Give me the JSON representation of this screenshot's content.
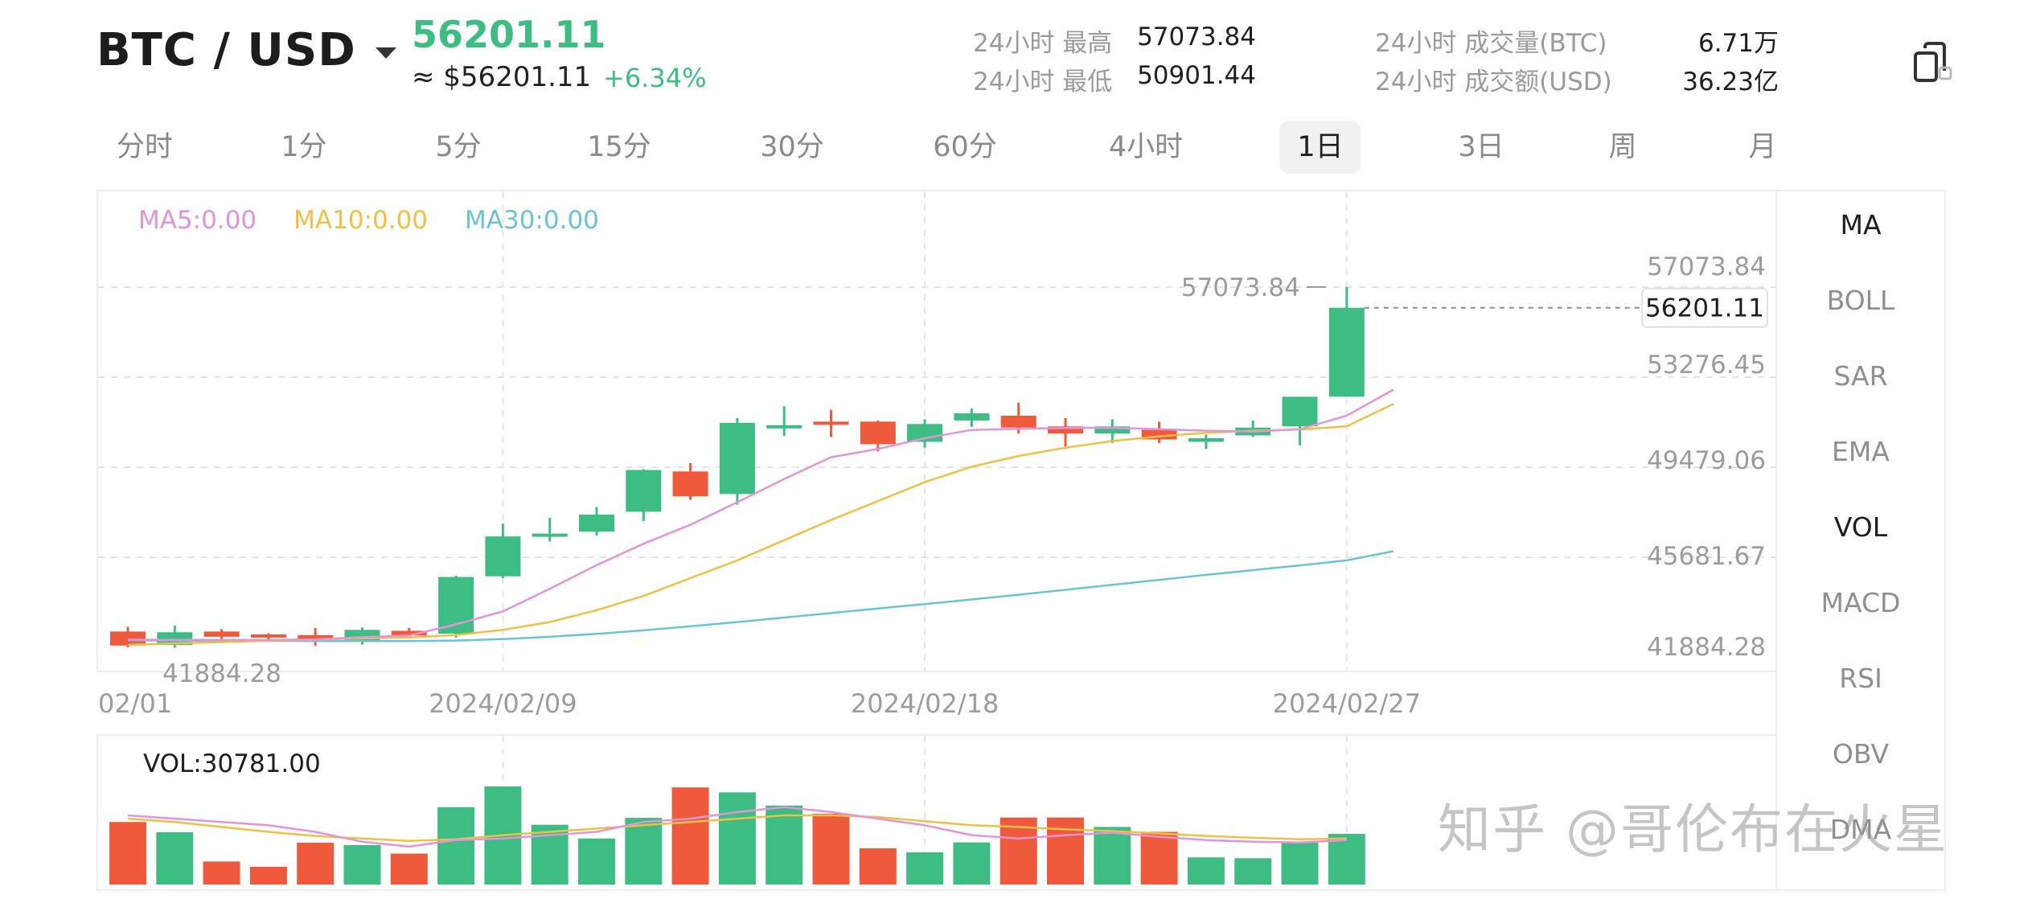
{
  "header": {
    "pair": "BTC  /  USD",
    "price": "56201.11",
    "price_usd": "≈ $56201.11",
    "change": "+6.34%",
    "stats": {
      "high_label": "24小时 最高",
      "high_value": "57073.84",
      "low_label": "24小时 最低",
      "low_value": "50901.44",
      "vol_btc_label": "24小时 成交量(BTC)",
      "vol_btc_value": "6.71万",
      "vol_usd_label": "24小时 成交额(USD)",
      "vol_usd_value": "36.23亿"
    }
  },
  "tabs": [
    "分时",
    "1分",
    "5分",
    "15分",
    "30分",
    "60分",
    "4小时",
    "1日",
    "3日",
    "周",
    "月"
  ],
  "active_tab": "1日",
  "indicators": [
    "MA",
    "BOLL",
    "SAR",
    "EMA",
    "VOL",
    "MACD",
    "RSI",
    "OBV",
    "DMA"
  ],
  "active_indicators": [
    "MA",
    "VOL"
  ],
  "ma_legend": {
    "ma5": "MA5:0.00",
    "ma10": "MA10:0.00",
    "ma30": "MA30:0.00"
  },
  "vol_label": "VOL:30781.00",
  "watermark": "知乎 @哥伦布在火星",
  "colors": {
    "up": "#3dbd84",
    "down": "#f05a3c",
    "ma5": "#e294d8",
    "ma10": "#eec046",
    "ma30": "#6bc3d4",
    "grid": "#e4e4e4",
    "axis_text": "#9c9c9c"
  },
  "chart_data": [
    {
      "type": "candlestick",
      "ylim": [
        41884.28,
        57073.84
      ],
      "y_ticks": [
        "57073.84",
        "53276.45",
        "49479.06",
        "45681.67",
        "41884.28"
      ],
      "x_tick_labels": [
        "02/01",
        "2024/02/09",
        "2024/02/18",
        "2024/02/27"
      ],
      "x_tick_index": [
        0,
        8,
        17,
        26
      ],
      "max_label": "57073.84",
      "min_label": "41884.28",
      "last_price_label": "56201.11",
      "candles": [
        {
          "open": 42550,
          "close": 41960,
          "high": 42750,
          "low": 41884
        },
        {
          "open": 41980,
          "close": 42520,
          "high": 42800,
          "low": 41870
        },
        {
          "open": 42550,
          "close": 42330,
          "high": 42650,
          "low": 42150
        },
        {
          "open": 42430,
          "close": 42300,
          "high": 42480,
          "low": 42120
        },
        {
          "open": 42400,
          "close": 42180,
          "high": 42700,
          "low": 41950
        },
        {
          "open": 42150,
          "close": 42620,
          "high": 42720,
          "low": 42000
        },
        {
          "open": 42580,
          "close": 42380,
          "high": 42700,
          "low": 42250
        },
        {
          "open": 42460,
          "close": 44850,
          "high": 44900,
          "low": 42300
        },
        {
          "open": 44880,
          "close": 46560,
          "high": 47100,
          "low": 44800
        },
        {
          "open": 46560,
          "close": 46680,
          "high": 47350,
          "low": 46350
        },
        {
          "open": 46760,
          "close": 47480,
          "high": 47800,
          "low": 46600
        },
        {
          "open": 47600,
          "close": 49360,
          "high": 49400,
          "low": 47200
        },
        {
          "open": 49300,
          "close": 48250,
          "high": 49650,
          "low": 48100
        },
        {
          "open": 48350,
          "close": 51350,
          "high": 51550,
          "low": 47900
        },
        {
          "open": 51150,
          "close": 51250,
          "high": 52050,
          "low": 50800
        },
        {
          "open": 51400,
          "close": 51300,
          "high": 51900,
          "low": 50750
        },
        {
          "open": 51400,
          "close": 50450,
          "high": 51450,
          "low": 50150
        },
        {
          "open": 50550,
          "close": 51300,
          "high": 51500,
          "low": 50300
        },
        {
          "open": 51450,
          "close": 51750,
          "high": 51950,
          "low": 51180
        },
        {
          "open": 51650,
          "close": 51150,
          "high": 52200,
          "low": 50900
        },
        {
          "open": 51200,
          "close": 50900,
          "high": 51550,
          "low": 50350
        },
        {
          "open": 50900,
          "close": 51200,
          "high": 51500,
          "low": 50500
        },
        {
          "open": 51050,
          "close": 50650,
          "high": 51400,
          "low": 50500
        },
        {
          "open": 50550,
          "close": 50700,
          "high": 50850,
          "low": 50250
        },
        {
          "open": 50820,
          "close": 51150,
          "high": 51450,
          "low": 50750
        },
        {
          "open": 51200,
          "close": 52450,
          "high": 52450,
          "low": 50400
        },
        {
          "open": 52450,
          "close": 56201.11,
          "high": 57073.84,
          "low": 52450
        }
      ],
      "ma5": [
        42210,
        42200,
        42195,
        42190,
        42220,
        42310,
        42380,
        42850,
        43400,
        44350,
        45350,
        46250,
        47050,
        48000,
        48980,
        49900,
        50250,
        50700,
        51050,
        51100,
        51130,
        51140,
        51080,
        51020,
        50980,
        51080,
        51650,
        52750
      ],
      "ma10": [
        41990,
        42050,
        42100,
        42160,
        42210,
        42260,
        42300,
        42400,
        42620,
        42950,
        43450,
        44050,
        44800,
        45550,
        46400,
        47250,
        48050,
        48850,
        49500,
        49950,
        50300,
        50580,
        50780,
        50930,
        51010,
        51070,
        51200,
        52150
      ],
      "ma30": [
        42180,
        42170,
        42160,
        42155,
        42150,
        42148,
        42150,
        42170,
        42230,
        42330,
        42450,
        42600,
        42770,
        42950,
        43140,
        43330,
        43520,
        43710,
        43900,
        44100,
        44310,
        44520,
        44730,
        44940,
        45140,
        45340,
        45550,
        45940
      ]
    },
    {
      "type": "bar",
      "title": "VOL:30781.00",
      "values": [
        38000,
        31800,
        14000,
        10800,
        25400,
        24000,
        18800,
        47000,
        59600,
        36300,
        28000,
        40500,
        59000,
        56000,
        48000,
        43000,
        22000,
        19600,
        25600,
        40700,
        40700,
        35000,
        32000,
        16500,
        16000,
        26000,
        30781
      ],
      "ma5": [
        42000,
        40000,
        38000,
        36000,
        32000,
        26000,
        23000,
        27000,
        28000,
        30000,
        32000,
        38000,
        40000,
        44000,
        47000,
        44000,
        40000,
        36000,
        30000,
        28000,
        30000,
        31500,
        29000,
        27000,
        26000,
        25500,
        27000
      ],
      "ma10": [
        40000,
        38000,
        35000,
        32000,
        29500,
        28000,
        26500,
        27500,
        30000,
        32000,
        34000,
        36000,
        38000,
        40000,
        42000,
        42000,
        41000,
        38500,
        36000,
        35000,
        33500,
        32500,
        31000,
        29500,
        28500,
        27500,
        28000
      ]
    }
  ]
}
